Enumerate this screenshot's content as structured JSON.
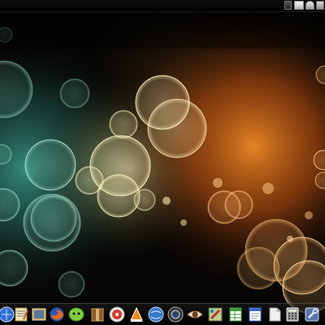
{
  "screen": {
    "description_colors": {
      "background": "#0a0806",
      "teal_glow": "#2e7a6c",
      "orange_glow": "#e07a1e",
      "bokeh_ring": "#f2e7b0"
    }
  },
  "top_panel": {
    "tray_icons": [
      {
        "name": "network-icon"
      },
      {
        "name": "window-list-icon"
      },
      {
        "name": "clock-icon"
      },
      {
        "name": "tray-extra-icon"
      }
    ]
  },
  "dock": {
    "icons": [
      {
        "name": "web-browser-icon",
        "color": "#2f6fd6"
      },
      {
        "name": "text-editor-icon",
        "color": "#e8d9a0"
      },
      {
        "name": "image-viewer-icon",
        "color": "#c7a66a"
      },
      {
        "name": "firefox-icon",
        "color": "#e3661f"
      },
      {
        "name": "pidgin-chat-icon",
        "color": "#7fcf3a"
      },
      {
        "name": "archive-manager-icon",
        "color": "#8a5a2b"
      },
      {
        "name": "media-player-icon",
        "color": "#d63a2a"
      },
      {
        "name": "vlc-icon",
        "color": "#f08a1c"
      },
      {
        "name": "browser-globe-icon",
        "color": "#3a78c9"
      },
      {
        "name": "camera-icon",
        "color": "#555555"
      },
      {
        "name": "eye-of-gnome-icon",
        "color": "#b0703a"
      },
      {
        "name": "paint-icon",
        "color": "#6a9a3a"
      },
      {
        "name": "spreadsheet-icon",
        "color": "#3f9a3f"
      },
      {
        "name": "word-processor-icon",
        "color": "#3a6cc9"
      },
      {
        "name": "document-icon",
        "color": "#e6e6e6"
      },
      {
        "name": "calculator-icon",
        "color": "#9a9a9a"
      },
      {
        "name": "tools-icon",
        "color": "#5a78b0"
      }
    ]
  }
}
